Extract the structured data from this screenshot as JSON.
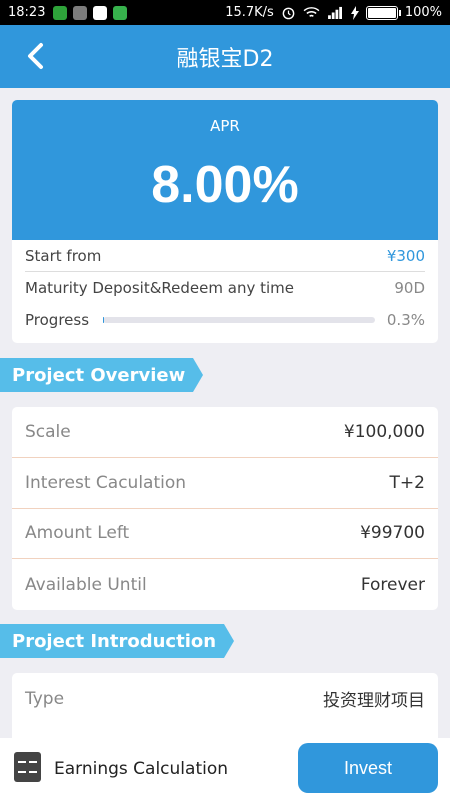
{
  "status_bar": {
    "time": "18:23",
    "network_speed": "15.7K/s",
    "battery": "100%"
  },
  "header": {
    "title": "融银宝D2",
    "back_icon": "chevron-left-icon"
  },
  "apr_card": {
    "label": "APR",
    "value": "8.00%",
    "start_from_label": "Start from",
    "start_from_value": "¥300",
    "maturity_label": "Maturity Deposit&Redeem any time",
    "maturity_value": "90D",
    "progress_label": "Progress",
    "progress_value": "0.3%",
    "progress_fraction": 0.003
  },
  "overview": {
    "title": "Project Overview",
    "rows": [
      {
        "label": "Scale",
        "value": "¥100,000"
      },
      {
        "label": "Interest Caculation",
        "value": "T+2"
      },
      {
        "label": "Amount Left",
        "value": "¥99700"
      },
      {
        "label": "Available Until",
        "value": "Forever"
      }
    ]
  },
  "introduction": {
    "title": "Project Introduction",
    "rows": [
      {
        "label": "Type",
        "value": "投资理财项目"
      }
    ]
  },
  "bottom_bar": {
    "calc_label": "Earnings Calculation",
    "calc_icon": "calculator-icon",
    "invest_label": "Invest"
  },
  "colors": {
    "primary": "#3097dc",
    "tag": "#56bde9",
    "background": "#eeeef3"
  }
}
